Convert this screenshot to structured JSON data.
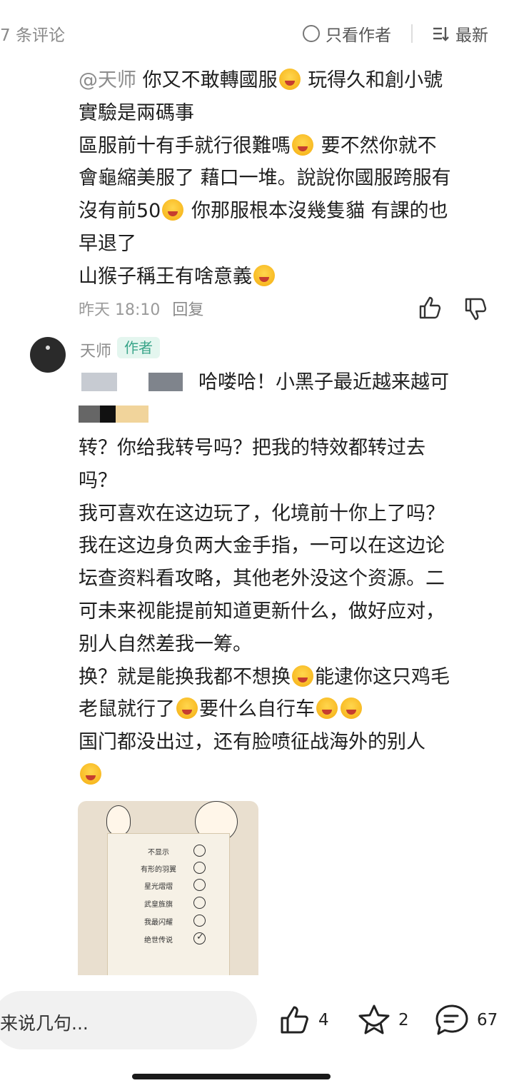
{
  "topbar": {
    "comment_count": "7 条评论",
    "only_author": "只看作者",
    "sort": "最新"
  },
  "comment1": {
    "mention": "@天师",
    "lines": [
      "你又不敢轉國服",
      "玩得久和創小號",
      "實驗是兩碼事",
      "區服前十有手就行很難嗎",
      "要不然你就不",
      "會龜縮美服了 藉口一堆。說說你國服跨服有",
      "沒有前50",
      "你那服根本沒幾隻貓 有課的也",
      "早退了",
      "山猴子稱王有啥意義"
    ],
    "time": "昨天 18:10",
    "reply": "回复"
  },
  "comment2": {
    "username": "天师",
    "badge": "作者",
    "lines": [
      "哈喽哈！小黑子最近越来越可",
      "转？你给我转号吗？把我的特效都转过去",
      "吗？",
      "我可喜欢在这边玩了，化境前十你上了吗？",
      "我在这边身负两大金手指，一可以在这边论",
      "坛查资料看攻略，其他老外没这个资源。二",
      "可未来视能提前知道更新什么，做好应对，",
      "别人自然差我一筹。",
      "换？就是能换我都不想换",
      "能逮你这只鸡毛",
      "老鼠就行了",
      "要什么自行车",
      "国门都没出过，还有脸喷征战海外的别人"
    ],
    "image_options": [
      "不显示",
      "有形的羽翼",
      "星光熠熠",
      "武皇旌旗",
      "我最闪耀",
      "绝世传说"
    ],
    "image_selected": "绝世传说"
  },
  "bottombar": {
    "input_placeholder": "来说几句...",
    "likes": "4",
    "favorites": "2",
    "comments": "67"
  }
}
